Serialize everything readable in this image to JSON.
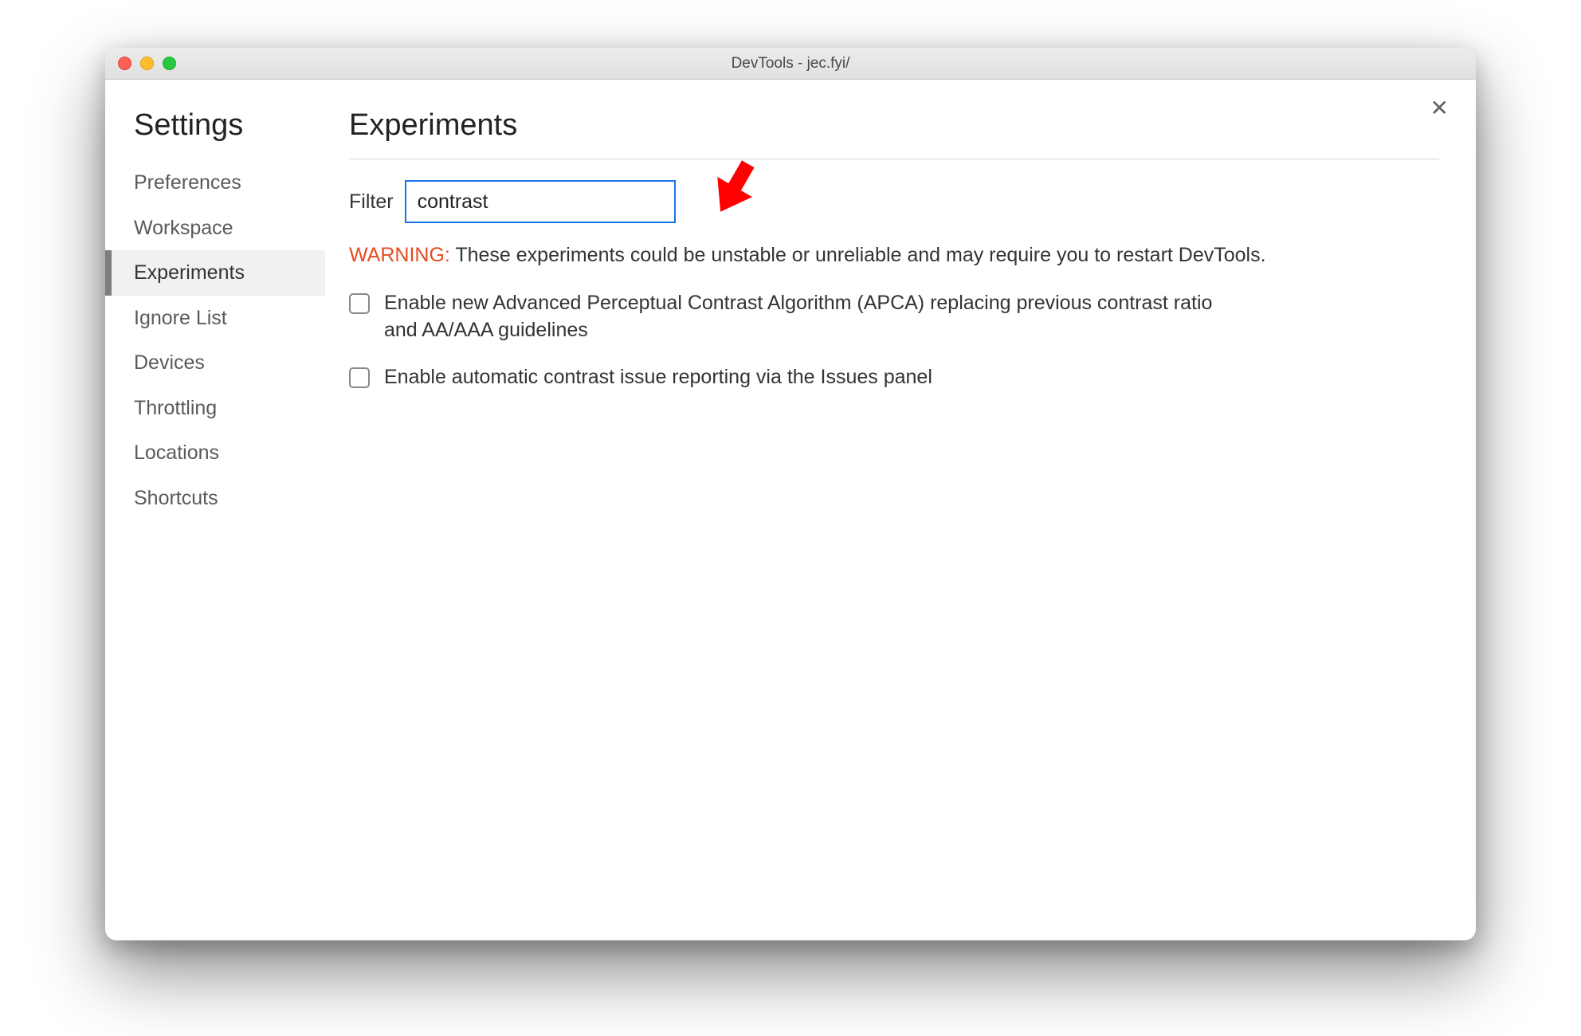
{
  "window": {
    "title": "DevTools - jec.fyi/"
  },
  "close_label": "✕",
  "sidebar": {
    "title": "Settings",
    "items": [
      {
        "label": "Preferences",
        "active": false
      },
      {
        "label": "Workspace",
        "active": false
      },
      {
        "label": "Experiments",
        "active": true
      },
      {
        "label": "Ignore List",
        "active": false
      },
      {
        "label": "Devices",
        "active": false
      },
      {
        "label": "Throttling",
        "active": false
      },
      {
        "label": "Locations",
        "active": false
      },
      {
        "label": "Shortcuts",
        "active": false
      }
    ]
  },
  "main": {
    "title": "Experiments",
    "filter_label": "Filter",
    "filter_value": "contrast",
    "warning_prefix": "WARNING:",
    "warning_text": " These experiments could be unstable or unreliable and may require you to restart DevTools.",
    "experiments": [
      {
        "label": "Enable new Advanced Perceptual Contrast Algorithm (APCA) replacing previous contrast ratio and AA/AAA guidelines",
        "checked": false
      },
      {
        "label": "Enable automatic contrast issue reporting via the Issues panel",
        "checked": false
      }
    ]
  }
}
